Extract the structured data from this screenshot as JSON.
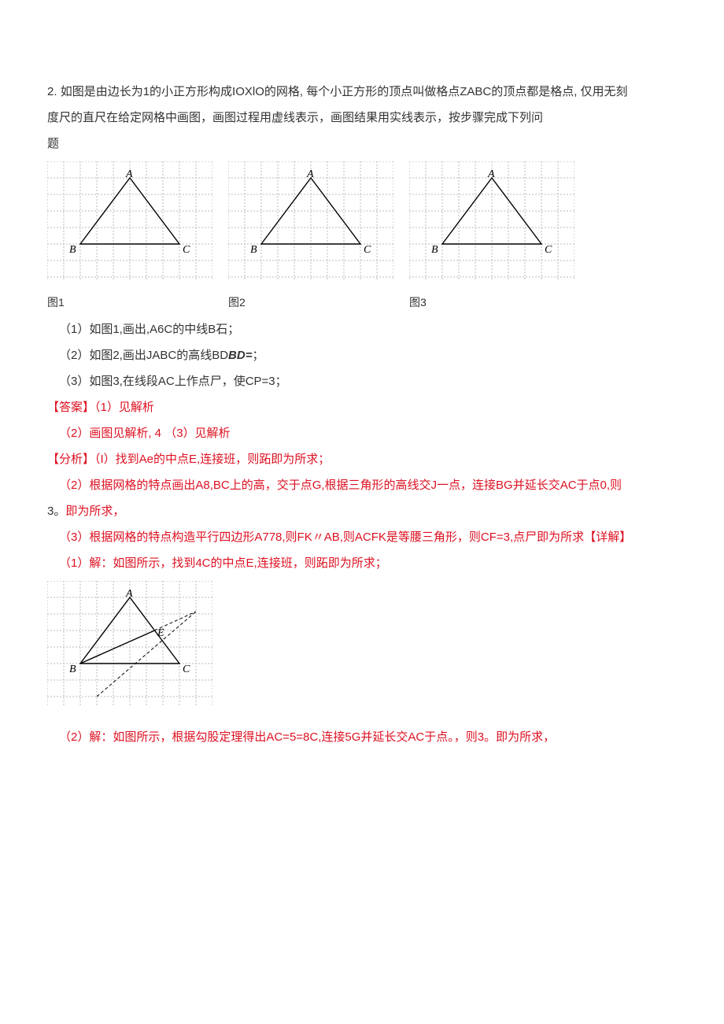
{
  "q": {
    "num": "2.",
    "stem_a": "如图是由边长为1的小正方形构成IOXlO的网格, 每个小正方形的顶点叫做格点ZABC的顶点都是格点, 仅用无刻",
    "stem_b": "度尺的直尺在给定网格中画图，画图过程用虚线表示，画图结果用实线表示，按步骤完成下列问",
    "stem_c": "题"
  },
  "figlabels": {
    "f1": "图1",
    "f2": "图2",
    "f3": "图3"
  },
  "pts": {
    "A": "A",
    "B": "B",
    "C": "C",
    "E": "E"
  },
  "parts": {
    "p1": "（1）如图1,画出,A6C的中线B石；",
    "p2a": "（2）如图2,画出JABC的高线BD",
    "p2b": "BD=",
    "p2c": "；",
    "p3": "（3）如图3,在线段AC上作点尸，使CP=3；"
  },
  "ans": {
    "hdr": "【答案】（1）见解析",
    "l2a": "（2）画图见解析, 4",
    "l2b": "（3）见解析"
  },
  "analysis": {
    "hdr": "【分析】（I）找到Ae的中点E,连接班，则跖即为所求；",
    "l2a": "（2）根据网格的特点画出A8,BC上的高，交于点G,根据三角形的高线交J一点，连接BG并延长交AC于点0,则",
    "l2b_a": "3。",
    "l2b_b": "即为所求，",
    "l3a": "（3）根据网格的特点构造平行四边形A778,则FK〃AB,则ACFK是等腰三角形，则CF=3,点尸即为",
    "l3b": "所求",
    "detail_hdr": "【详解】"
  },
  "detail": {
    "d1": "（1）解：如图所示，找到4C的中点E,连接班，则跖即为所求；",
    "d2_a": "（2）解：如图所示，根据勾股定理得出AC=5=8C,连接5G并延长交AC于点。，则3。",
    "d2_b": "即为所求，"
  },
  "chart_data": {
    "type": "diagram",
    "note": "Three identical 10x10 unit grids each containing triangle ABC with vertices at grid points; a fourth grid shows the same triangle with midpoint E of AC and median BE drawn (dashed construction).",
    "grid": {
      "cols": 10,
      "rows": 7,
      "unit": 1
    },
    "triangle_ABC": {
      "A": [
        5,
        1
      ],
      "B": [
        2,
        5
      ],
      "C": [
        8,
        5
      ]
    },
    "figure4_extra": {
      "E": [
        6.5,
        3
      ],
      "median": [
        "B",
        "E"
      ],
      "dashed_extension_beyond_E": true
    }
  }
}
